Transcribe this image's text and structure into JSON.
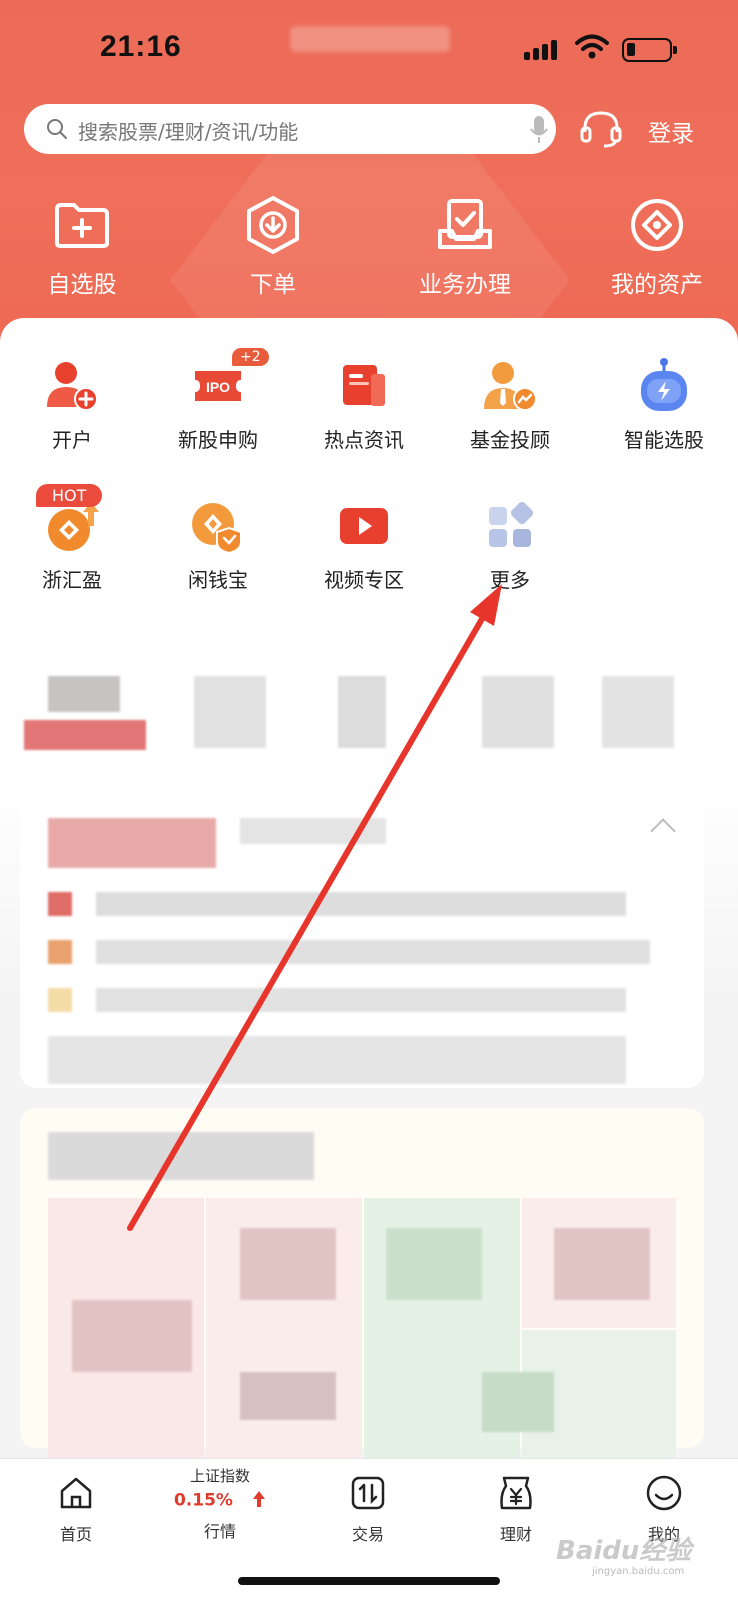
{
  "status_bar": {
    "time": "21:16"
  },
  "search": {
    "placeholder": "搜索股票/理财/资讯/功能"
  },
  "header": {
    "login_label": "登录"
  },
  "top_nav": [
    {
      "label": "自选股",
      "icon": "folder-plus-icon"
    },
    {
      "label": "下单",
      "icon": "download-hexagon-icon"
    },
    {
      "label": "业务办理",
      "icon": "checklist-tray-icon"
    },
    {
      "label": "我的资产",
      "icon": "coin-circle-icon"
    }
  ],
  "grid": [
    {
      "label": "开户",
      "icon": "user-add-icon"
    },
    {
      "label": "新股申购",
      "icon": "ipo-ticket-icon",
      "badge": "+2"
    },
    {
      "label": "热点资讯",
      "icon": "news-icon"
    },
    {
      "label": "基金投顾",
      "icon": "advisor-icon"
    },
    {
      "label": "智能选股",
      "icon": "robot-icon"
    },
    {
      "label": "浙汇盈",
      "icon": "money-up-icon",
      "badge": "HOT"
    },
    {
      "label": "闲钱宝",
      "icon": "wallet-shield-icon"
    },
    {
      "label": "视频专区",
      "icon": "video-play-icon"
    },
    {
      "label": "更多",
      "icon": "grid-more-icon"
    }
  ],
  "tabbar": {
    "index_name": "上证指数",
    "index_change": "0.15%",
    "tabs": [
      {
        "label": "首页",
        "icon": "home-icon"
      },
      {
        "label": "行情",
        "icon": "market-icon"
      },
      {
        "label": "交易",
        "icon": "trade-icon"
      },
      {
        "label": "理财",
        "icon": "yen-bag-icon"
      },
      {
        "label": "我的",
        "icon": "profile-icon"
      }
    ]
  },
  "watermark": {
    "text": "Baidu经验",
    "sub": "jingyan.baidu.com"
  },
  "colors": {
    "brand": "#ee6852",
    "accent_red": "#e03c2d",
    "arrow": "#e8352c"
  }
}
